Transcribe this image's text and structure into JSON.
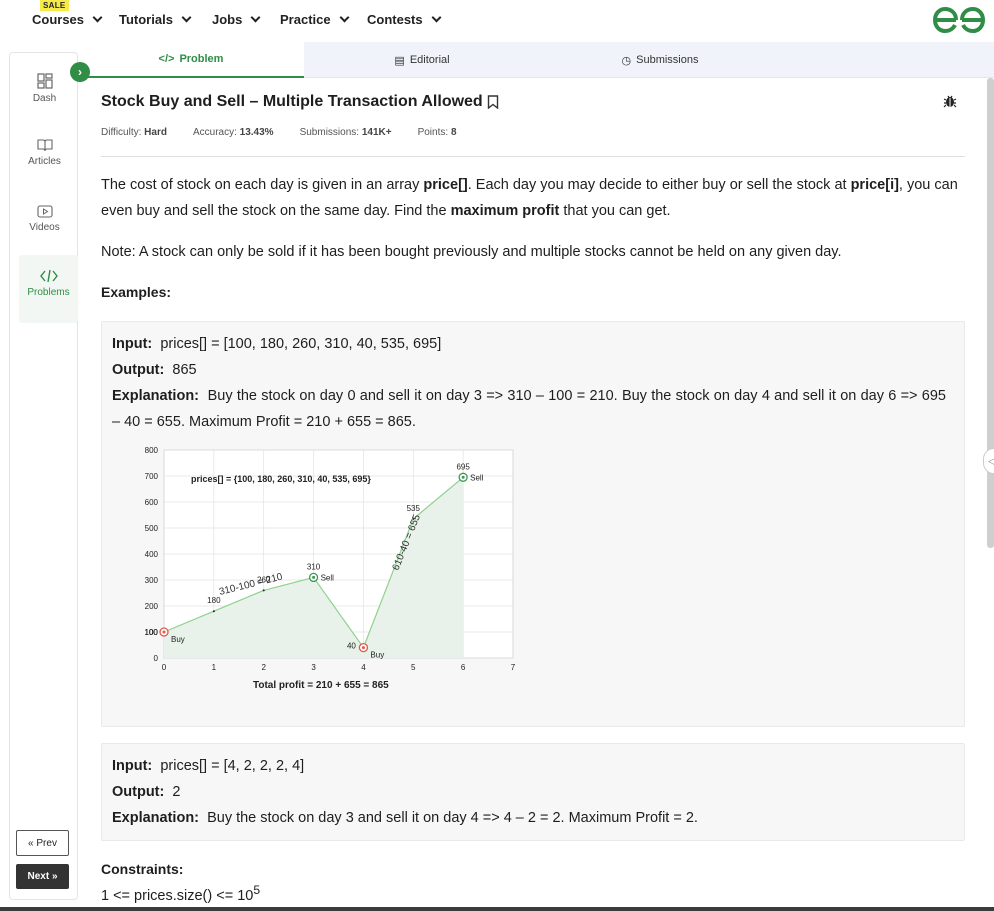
{
  "nav": {
    "sale_badge": "SALE",
    "items": [
      "Courses",
      "Tutorials",
      "Jobs",
      "Practice",
      "Contests"
    ]
  },
  "tabs": [
    {
      "icon": "</>",
      "label": "Problem"
    },
    {
      "icon": "▤",
      "label": "Editorial"
    },
    {
      "icon": "◷",
      "label": "Submissions"
    }
  ],
  "sidebar": {
    "items": [
      {
        "label": "Dash",
        "icon": "dashboard-icon"
      },
      {
        "label": "Articles",
        "icon": "book-icon"
      },
      {
        "label": "Videos",
        "icon": "video-icon"
      },
      {
        "label": "Problems",
        "icon": "code-icon"
      }
    ],
    "prev_label": "« Prev",
    "next_label": "Next »"
  },
  "problem": {
    "title": "Stock Buy and Sell – Multiple Transaction Allowed",
    "difficulty_label": "Difficulty:",
    "difficulty": "Hard",
    "accuracy_label": "Accuracy:",
    "accuracy": "13.43%",
    "submissions_label": "Submissions:",
    "submissions": "141K+",
    "points_label": "Points:",
    "points": "8",
    "desc": {
      "p1": "The cost of stock on each day is given in an array ",
      "b1": "price[]",
      "p2": ". Each day you may decide to either buy or sell the stock at ",
      "b2": "price[i]",
      "p3": ", you can even buy and sell the stock on the same day. Find the ",
      "b3": "maximum profit",
      "p4": " that you can get."
    },
    "note": "Note: A stock can only be sold if it has been bought previously and multiple stocks cannot be held on any given day.",
    "examples_heading": "Examples:",
    "example1": {
      "input_label": "Input:",
      "input": "prices[] = [100, 180, 260, 310, 40, 535, 695]",
      "output_label": "Output:",
      "output": "865",
      "explanation_label": "Explanation:",
      "explanation": "Buy the stock on day 0 and sell it on day 3 => 310 – 100 = 210. Buy the stock on day 4 and sell it on day 6 => 695 – 40 = 655. Maximum Profit = 210 + 655 = 865."
    },
    "example2": {
      "input_label": "Input:",
      "input": "prices[] = [4, 2, 2, 2, 4]",
      "output_label": "Output:",
      "output": "2",
      "explanation_label": "Explanation:",
      "explanation": "Buy the stock on day 3 and sell it on day 4 => 4 – 2 = 2. Maximum Profit = 2."
    },
    "constraints_heading": "Constraints:",
    "constraint1": "1 <= prices.size() <= 10",
    "constraint1_exp": "5"
  },
  "chart_data": {
    "type": "line",
    "x": [
      0,
      1,
      2,
      3,
      4,
      5,
      6
    ],
    "values": [
      100,
      180,
      260,
      310,
      40,
      535,
      695
    ],
    "xlim": [
      0,
      7
    ],
    "ylim": [
      0,
      800
    ],
    "xticks": [
      "0",
      "1",
      "2",
      "3",
      "4",
      "5",
      "6",
      "7"
    ],
    "yticks": [
      "0",
      "100",
      "200",
      "300",
      "400",
      "500",
      "600",
      "700",
      "800"
    ],
    "data_labels": [
      "100",
      "180",
      "260",
      "310",
      "40",
      "535",
      "695"
    ],
    "grid": true,
    "annotation_title": "prices[] = {100, 180, 260, 310, 40, 535, 695}",
    "segment_labels": [
      "310-100 = 210",
      "610-40 = 655"
    ],
    "markers": [
      {
        "x": 0,
        "label": "Buy",
        "kind": "buy"
      },
      {
        "x": 3,
        "label": "Sell",
        "kind": "sell"
      },
      {
        "x": 4,
        "label": "Buy",
        "kind": "buy"
      },
      {
        "x": 6,
        "label": "Sell",
        "kind": "sell"
      }
    ],
    "footer": "Total profit = 210 + 655 = 865",
    "colors": {
      "line": "#8fd18f",
      "fill": "#e8f2ea",
      "buy": "#e05a4a",
      "sell": "#3c9a52"
    }
  }
}
